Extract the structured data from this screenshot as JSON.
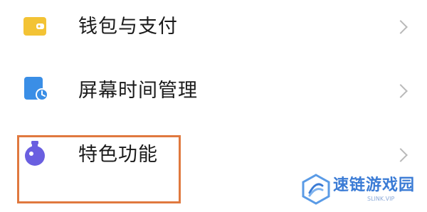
{
  "settings": {
    "items": [
      {
        "label": "钱包与支付",
        "icon": "wallet-icon"
      },
      {
        "label": "屏幕时间管理",
        "icon": "screen-time-icon"
      },
      {
        "label": "特色功能",
        "icon": "flask-icon"
      }
    ]
  },
  "highlight": {
    "color": "#e0793f"
  },
  "watermark": {
    "text": "速链游戏园",
    "subtext": "SLINK.VIP"
  },
  "colors": {
    "wallet_icon": "#f3c335",
    "screen_icon": "#3a8ee6",
    "flask_icon": "#6a5fe0",
    "chevron": "#b9b9b9"
  }
}
